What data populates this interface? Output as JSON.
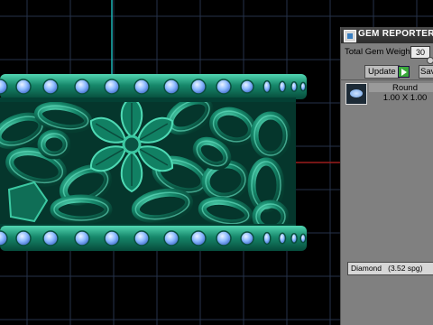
{
  "viewport": {
    "ring_label": "Jewelry ring 3D model with stone-set bands",
    "colors": {
      "background": "#000000",
      "grid": "#26324a",
      "metal": "#0d6b55",
      "metal_light": "#2ab08d",
      "stone": "#7fb2ff",
      "axis_red": "#9b1c1c",
      "axis_cyan": "#1bb3b3"
    }
  },
  "gem_reporter": {
    "title": "GEM REPORTER",
    "weight_label": "Total Gem Weight",
    "weight_value": "30",
    "update_label": "Update",
    "save_label": "Sav",
    "gem": {
      "cut": "Round",
      "size": "1.00 X 1.00"
    },
    "material": "Diamond",
    "material_detail": "(3.52 spg)"
  }
}
